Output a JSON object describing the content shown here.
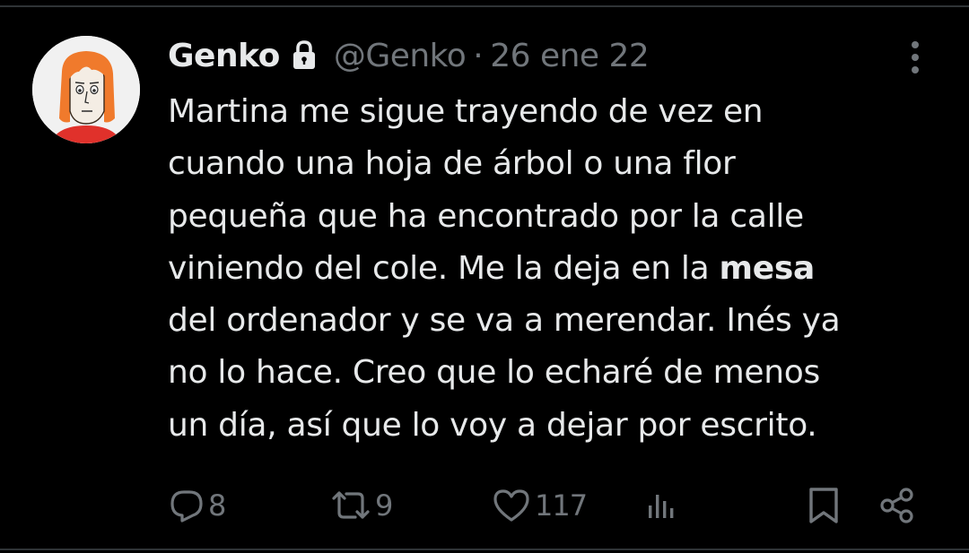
{
  "tweet": {
    "author_name": "Genko",
    "handle": "@Genko",
    "separator": "·",
    "date": "26 ene 22",
    "text_lines": [
      {
        "before": "Martina me sigue trayendo de vez en",
        "bold": "",
        "after": ""
      },
      {
        "before": "cuando una hoja de árbol o una flor",
        "bold": "",
        "after": ""
      },
      {
        "before": "pequeña que ha encontrado por la calle",
        "bold": "",
        "after": ""
      },
      {
        "before": "viniendo del cole. Me la deja en la ",
        "bold": "mesa",
        "after": ""
      },
      {
        "before": "del ordenador y se va a merendar. Inés ya",
        "bold": "",
        "after": ""
      },
      {
        "before": "no lo hace. Creo que lo echaré de menos",
        "bold": "",
        "after": ""
      },
      {
        "before": "un día, así que lo voy a dejar por escrito.",
        "bold": "",
        "after": ""
      }
    ]
  },
  "icons": {
    "lock": "lock-icon",
    "more": "more-icon",
    "reply": "reply-icon",
    "retweet": "retweet-icon",
    "like": "heart-icon",
    "views": "views-icon",
    "bookmark": "bookmark-icon",
    "share": "share-icon"
  },
  "actions": {
    "replies": "8",
    "retweets": "9",
    "likes": "117"
  },
  "colors": {
    "background": "#000000",
    "text_primary": "#e7e9ea",
    "text_secondary": "#71767b",
    "divider": "#2f3336",
    "avatar_hair": "#f07a2c",
    "avatar_shirt": "#e0312b"
  }
}
